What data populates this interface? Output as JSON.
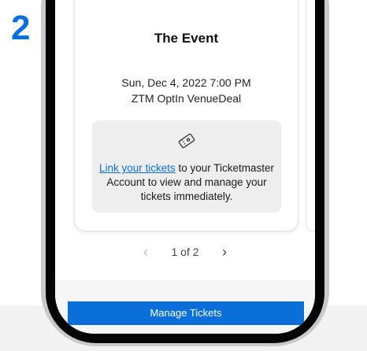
{
  "step": {
    "number": "2"
  },
  "event": {
    "title": "The Event",
    "datetime": "Sun, Dec 4, 2022 7:00 PM",
    "venue": "ZTM OptIn VenueDeal"
  },
  "link_box": {
    "icon": "ticket-icon",
    "link_label": "Link your tickets",
    "message": " to your Ticketmaster Account to view and manage your tickets immediately."
  },
  "pager": {
    "prev_icon": "chevron-left-icon",
    "next_icon": "chevron-right-icon",
    "label": "1 of 2"
  },
  "footer": {
    "manage_label": "Manage Tickets"
  },
  "colors": {
    "accent": "#0b6fd9"
  }
}
